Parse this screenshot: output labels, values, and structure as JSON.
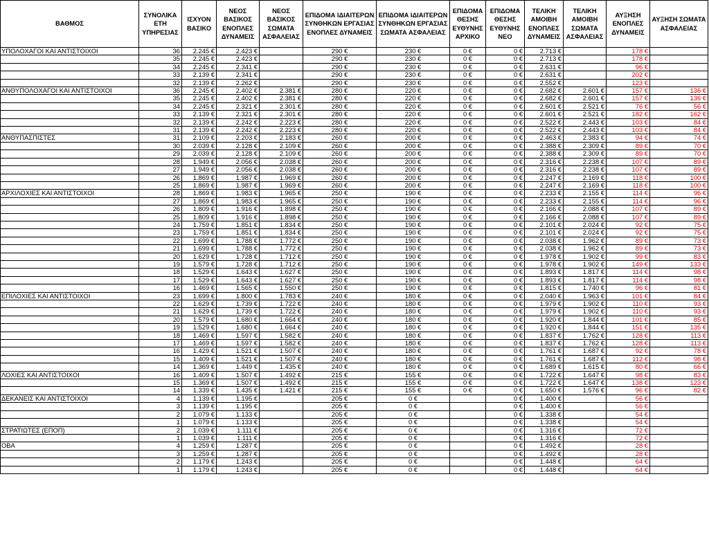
{
  "headers": [
    "ΒΑΘΜΟΣ",
    "ΣΥΝΟΛΙΚΑ ΕΤΗ ΥΠΗΡΕΣΙΑΣ",
    "ΙΣΧΥΟΝ ΒΑΣΙΚΟ",
    "ΝΕΟΣ ΒΑΣΙΚΟΣ ΕΝΟΠΛΕΣ ΔΥΝΑΜΕΙΣ",
    "ΝΕΟΣ ΒΑΣΙΚΟΣ ΣΩΜΑΤΑ ΑΣΦΑΛΕΙΑΣ",
    "ΕΠΙΔΟΜΑ ΙΔΙΑΙΤΕΡΩΝ ΣΥΝΘΗΚΩΝ ΕΡΓΑΣΙΑΣ ΕΝΟΠΛΕΣ ΔΥΝΑΜΕΙΣ",
    "ΕΠΙΔΟΜΑ ΙΔΙΑΙΤΕΡΩΝ ΣΥΝΘΗΚΩΝ ΕΡΓΑΣΙΑΣ ΣΩΜΑΤΑ ΑΣΦΑΛΕΙΑΣ",
    "ΕΠΙΔΟΜΑ ΘΕΣΗΣ ΕΥΘΥΝΗΣ ΑΡΧΙΚΟ",
    "ΕΠΙΔΟΜΑ ΘΕΣΗΣ ΕΥΘΥΝΗΣ ΝΕΟ",
    "ΤΕΛΙΚΗ ΑΜΟΙΒΗ ΕΝΟΠΛΕΣ ΔΥΝΑΜΕΙΣ",
    "ΤΕΛΙΚΗ ΑΜΟΙΒΗ ΣΩΜΑΤΑ ΑΣΦΑΛΕΙΑΣ",
    "ΑΥΞΗΣΗ ΕΝΟΠΛΕΣ ΔΥΝΑΜΕΙΣ",
    "ΑΥΞΗΣΗ ΣΩΜΑΤΑ ΑΣΦΑΛΕΙΑΣ"
  ],
  "colors": {
    "increase_text": "#e00000",
    "grid": "#000000"
  },
  "rows": [
    [
      "ΥΠΟΛΟΧΑΓΟΙ ΚΑΙ ΑΝΤΙΣΤΟΙΧΟΙ",
      "36",
      "2.245 €",
      "2.423 €",
      "",
      "290 €",
      "230 €",
      "0 €",
      "0 €",
      "2.713 €",
      "",
      "178 €",
      ""
    ],
    [
      "",
      "35",
      "2.245 €",
      "2.423 €",
      "",
      "290 €",
      "230 €",
      "0 €",
      "0 €",
      "2.713 €",
      "",
      "178 €",
      ""
    ],
    [
      "",
      "34",
      "2.245 €",
      "2.341 €",
      "",
      "290 €",
      "230 €",
      "0 €",
      "0 €",
      "2.631 €",
      "",
      "96 €",
      ""
    ],
    [
      "",
      "33",
      "2.139 €",
      "2.341 €",
      "",
      "290 €",
      "230 €",
      "0 €",
      "0 €",
      "2.631 €",
      "",
      "202 €",
      ""
    ],
    [
      "",
      "32",
      "2.139 €",
      "2.262 €",
      "",
      "290 €",
      "230 €",
      "0 €",
      "0 €",
      "2.552 €",
      "",
      "123 €",
      ""
    ],
    [
      "ΑΝΘΥΠΟΛΟΧΑΓΟΙ ΚΑΙ ΑΝΤΙΣΤΟΙΧΟΙ",
      "36",
      "2.245 €",
      "2.402 €",
      "2.381 €",
      "280 €",
      "220 €",
      "0 €",
      "0 €",
      "2.682 €",
      "2.601 €",
      "157 €",
      "136 €"
    ],
    [
      "",
      "35",
      "2.245 €",
      "2.402 €",
      "2.381 €",
      "280 €",
      "220 €",
      "0 €",
      "0 €",
      "2.682 €",
      "2.601 €",
      "157 €",
      "136 €"
    ],
    [
      "",
      "34",
      "2.245 €",
      "2.321 €",
      "2.301 €",
      "280 €",
      "220 €",
      "0 €",
      "0 €",
      "2.601 €",
      "2.521 €",
      "76 €",
      "56 €"
    ],
    [
      "",
      "33",
      "2.139 €",
      "2.321 €",
      "2.301 €",
      "280 €",
      "220 €",
      "0 €",
      "0 €",
      "2.601 €",
      "2.521 €",
      "182 €",
      "162 €"
    ],
    [
      "",
      "32",
      "2.139 €",
      "2.242 €",
      "2.223 €",
      "280 €",
      "220 €",
      "0 €",
      "0 €",
      "2.522 €",
      "2.443 €",
      "103 €",
      "84 €"
    ],
    [
      "",
      "31",
      "2.139 €",
      "2.242 €",
      "2.223 €",
      "280 €",
      "220 €",
      "0 €",
      "0 €",
      "2.522 €",
      "2.443 €",
      "103 €",
      "84 €"
    ],
    [
      "ΑΝΘΥΠΑΣΠΙΣΤΕΣ",
      "31",
      "2.109 €",
      "2.203 €",
      "2.183 €",
      "260 €",
      "200 €",
      "0 €",
      "0 €",
      "2.463 €",
      "2.383 €",
      "94 €",
      "74 €"
    ],
    [
      "",
      "30",
      "2.039 €",
      "2.128 €",
      "2.109 €",
      "260 €",
      "200 €",
      "0 €",
      "0 €",
      "2.388 €",
      "2.309 €",
      "89 €",
      "70 €"
    ],
    [
      "",
      "29",
      "2.039 €",
      "2.128 €",
      "2.109 €",
      "260 €",
      "200 €",
      "0 €",
      "0 €",
      "2.388 €",
      "2.309 €",
      "89 €",
      "70 €"
    ],
    [
      "",
      "28",
      "1.949 €",
      "2.056 €",
      "2.038 €",
      "260 €",
      "200 €",
      "0 €",
      "0 €",
      "2.316 €",
      "2.238 €",
      "107 €",
      "89 €"
    ],
    [
      "",
      "27",
      "1.949 €",
      "2.056 €",
      "2.038 €",
      "260 €",
      "200 €",
      "0 €",
      "0 €",
      "2.316 €",
      "2.238 €",
      "107 €",
      "89 €"
    ],
    [
      "",
      "26",
      "1.869 €",
      "1.987 €",
      "1.969 €",
      "260 €",
      "200 €",
      "0 €",
      "0 €",
      "2.247 €",
      "2.169 €",
      "118 €",
      "100 €"
    ],
    [
      "",
      "25",
      "1.869 €",
      "1.987 €",
      "1.969 €",
      "260 €",
      "200 €",
      "0 €",
      "0 €",
      "2.247 €",
      "2.169 €",
      "118 €",
      "100 €"
    ],
    [
      "ΑΡΧΙΛΟΧΙΕΣ ΚΑΙ ΑΝΤΙΣΤΟΙΧΟΙ",
      "28",
      "1.869 €",
      "1.983 €",
      "1.965 €",
      "250 €",
      "190 €",
      "0 €",
      "0 €",
      "2.233 €",
      "2.155 €",
      "114 €",
      "96 €"
    ],
    [
      "",
      "27",
      "1.869 €",
      "1.983 €",
      "1.965 €",
      "250 €",
      "190 €",
      "0 €",
      "0 €",
      "2.233 €",
      "2.155 €",
      "114 €",
      "96 €"
    ],
    [
      "",
      "26",
      "1.809 €",
      "1.916 €",
      "1.898 €",
      "250 €",
      "190 €",
      "0 €",
      "0 €",
      "2.166 €",
      "2.088 €",
      "107 €",
      "89 €"
    ],
    [
      "",
      "25",
      "1.809 €",
      "1.916 €",
      "1.898 €",
      "250 €",
      "190 €",
      "0 €",
      "0 €",
      "2.166 €",
      "2.088 €",
      "107 €",
      "89 €"
    ],
    [
      "",
      "24",
      "1.759 €",
      "1.851 €",
      "1.834 €",
      "250 €",
      "190 €",
      "0 €",
      "0 €",
      "2.101 €",
      "2.024 €",
      "92 €",
      "75 €"
    ],
    [
      "",
      "23",
      "1.759 €",
      "1.851 €",
      "1.834 €",
      "250 €",
      "190 €",
      "0 €",
      "0 €",
      "2.101 €",
      "2.024 €",
      "92 €",
      "75 €"
    ],
    [
      "",
      "22",
      "1.699 €",
      "1.788 €",
      "1.772 €",
      "250 €",
      "190 €",
      "0 €",
      "0 €",
      "2.038 €",
      "1.962 €",
      "89 €",
      "73 €"
    ],
    [
      "",
      "21",
      "1.699 €",
      "1.788 €",
      "1.772 €",
      "250 €",
      "190 €",
      "0 €",
      "0 €",
      "2.038 €",
      "1.962 €",
      "89 €",
      "73 €"
    ],
    [
      "",
      "20",
      "1.629 €",
      "1.728 €",
      "1.712 €",
      "250 €",
      "190 €",
      "0 €",
      "0 €",
      "1.978 €",
      "1.902 €",
      "99 €",
      "83 €"
    ],
    [
      "",
      "19",
      "1.579 €",
      "1.728 €",
      "1.712 €",
      "250 €",
      "190 €",
      "0 €",
      "0 €",
      "1.978 €",
      "1.902 €",
      "149 €",
      "133 €"
    ],
    [
      "",
      "18",
      "1.529 €",
      "1.643 €",
      "1.627 €",
      "250 €",
      "190 €",
      "0 €",
      "0 €",
      "1.893 €",
      "1.817 €",
      "114 €",
      "98 €"
    ],
    [
      "",
      "17",
      "1.529 €",
      "1.643 €",
      "1.627 €",
      "250 €",
      "190 €",
      "0 €",
      "0 €",
      "1.893 €",
      "1.817 €",
      "114 €",
      "98 €"
    ],
    [
      "",
      "16",
      "1.469 €",
      "1.565 €",
      "1.550 €",
      "250 €",
      "190 €",
      "0 €",
      "0 €",
      "1.815 €",
      "1.740 €",
      "96 €",
      "81 €"
    ],
    [
      "ΕΠΙΛΟΧΙΕΣ ΚΑΙ ΑΝΤΙΣΤΟΙΧΟΙ",
      "23",
      "1.699 €",
      "1.800 €",
      "1.783 €",
      "240 €",
      "180 €",
      "0 €",
      "0 €",
      "2.040 €",
      "1.963 €",
      "101 €",
      "84 €"
    ],
    [
      "",
      "22",
      "1.629 €",
      "1.739 €",
      "1.722 €",
      "240 €",
      "180 €",
      "0 €",
      "0 €",
      "1.979 €",
      "1.902 €",
      "110 €",
      "93 €"
    ],
    [
      "",
      "21",
      "1.629 €",
      "1.739 €",
      "1.722 €",
      "240 €",
      "180 €",
      "0 €",
      "0 €",
      "1.979 €",
      "1.902 €",
      "110 €",
      "93 €"
    ],
    [
      "",
      "20",
      "1.579 €",
      "1.680 €",
      "1.664 €",
      "240 €",
      "180 €",
      "0 €",
      "0 €",
      "1.920 €",
      "1.844 €",
      "101 €",
      "85 €"
    ],
    [
      "",
      "19",
      "1.529 €",
      "1.680 €",
      "1.664 €",
      "240 €",
      "180 €",
      "0 €",
      "0 €",
      "1.920 €",
      "1.844 €",
      "151 €",
      "135 €"
    ],
    [
      "",
      "18",
      "1.469 €",
      "1.597 €",
      "1.582 €",
      "240 €",
      "180 €",
      "0 €",
      "0 €",
      "1.837 €",
      "1.762 €",
      "128 €",
      "113 €"
    ],
    [
      "",
      "17",
      "1.469 €",
      "1.597 €",
      "1.582 €",
      "240 €",
      "180 €",
      "0 €",
      "0 €",
      "1.837 €",
      "1.762 €",
      "128 €",
      "113 €"
    ],
    [
      "",
      "16",
      "1.429 €",
      "1.521 €",
      "1.507 €",
      "240 €",
      "180 €",
      "0 €",
      "0 €",
      "1.761 €",
      "1.687 €",
      "92 €",
      "78 €"
    ],
    [
      "",
      "15",
      "1.409 €",
      "1.521 €",
      "1.507 €",
      "240 €",
      "180 €",
      "0 €",
      "0 €",
      "1.761 €",
      "1.687 €",
      "112 €",
      "98 €"
    ],
    [
      "",
      "14",
      "1.369 €",
      "1.449 €",
      "1.435 €",
      "240 €",
      "180 €",
      "0 €",
      "0 €",
      "1.689 €",
      "1.615 €",
      "80 €",
      "66 €"
    ],
    [
      "ΛΟΧΙΕΣ ΚΑΙ ΑΝΤΙΣΤΟΙΧΟΙ",
      "16",
      "1.409 €",
      "1.507 €",
      "1.492 €",
      "215 €",
      "155 €",
      "0 €",
      "0 €",
      "1.722 €",
      "1.647 €",
      "98 €",
      "83 €"
    ],
    [
      "",
      "15",
      "1.369 €",
      "1.507 €",
      "1.492 €",
      "215 €",
      "155 €",
      "0 €",
      "0 €",
      "1.722 €",
      "1.647 €",
      "138 €",
      "123 €"
    ],
    [
      "",
      "14",
      "1.339 €",
      "1.435 €",
      "1.421 €",
      "215 €",
      "155 €",
      "0 €",
      "0 €",
      "1.650 €",
      "1.576 €",
      "96 €",
      "82 €"
    ],
    [
      "ΔΕΚΑΝΕΙΣ ΚΑΙ ΑΝΤΙΣΤΟΙΧΟΙ",
      "4",
      "1.139 €",
      "1.195 €",
      "",
      "205 €",
      "0 €",
      "",
      "0 €",
      "1.400 €",
      "",
      "56 €",
      ""
    ],
    [
      "",
      "3",
      "1.139 €",
      "1.195 €",
      "",
      "205 €",
      "0 €",
      "",
      "0 €",
      "1.400 €",
      "",
      "56 €",
      ""
    ],
    [
      "",
      "2",
      "1.079 €",
      "1.133 €",
      "",
      "205 €",
      "0 €",
      "",
      "0 €",
      "1.338 €",
      "",
      "54 €",
      ""
    ],
    [
      "",
      "1",
      "1.079 €",
      "1.133 €",
      "",
      "205 €",
      "0 €",
      "",
      "0 €",
      "1.338 €",
      "",
      "54 €",
      ""
    ],
    [
      "ΣΤΡΑΤΙΩΤΕΣ (ΕΠΟΠ)",
      "2",
      "1.039 €",
      "1.111 €",
      "",
      "205 €",
      "0 €",
      "",
      "0 €",
      "1.316 €",
      "",
      "72 €",
      ""
    ],
    [
      "",
      "1",
      "1.039 €",
      "1.111 €",
      "",
      "205 €",
      "0 €",
      "",
      "0 €",
      "1.316 €",
      "",
      "72 €",
      ""
    ],
    [
      "ΟΒΑ",
      "4",
      "1.259 €",
      "1.287 €",
      "",
      "205 €",
      "0 €",
      "",
      "0 €",
      "1.492 €",
      "",
      "28 €",
      ""
    ],
    [
      "",
      "3",
      "1.259 €",
      "1.287 €",
      "",
      "205 €",
      "0 €",
      "",
      "0 €",
      "1.492 €",
      "",
      "28 €",
      ""
    ],
    [
      "",
      "2",
      "1.179 €",
      "1.243 €",
      "",
      "205 €",
      "0 €",
      "",
      "0 €",
      "1.448 €",
      "",
      "64 €",
      ""
    ],
    [
      "",
      "1",
      "1.179 €",
      "1.243 €",
      "",
      "205 €",
      "0 €",
      "",
      "0 €",
      "1.448 €",
      "",
      "64 €",
      ""
    ]
  ]
}
